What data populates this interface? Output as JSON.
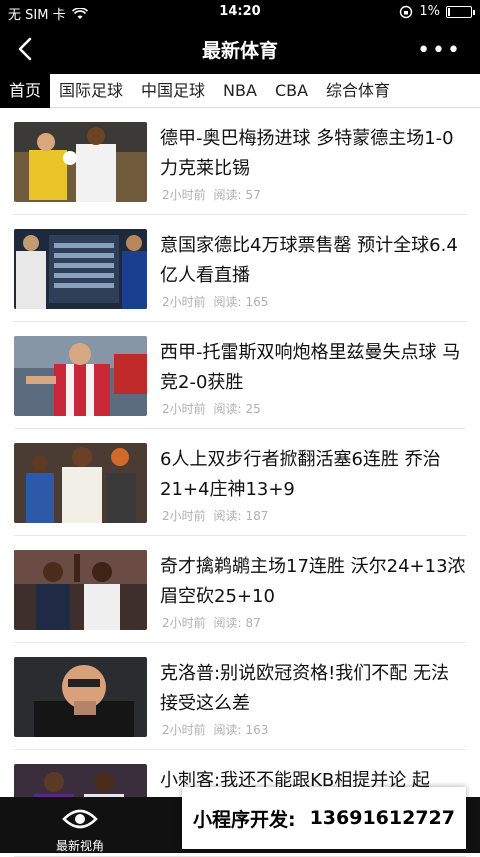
{
  "status_bar": {
    "carrier": "无 SIM 卡",
    "time": "14:20",
    "battery": "1%"
  },
  "header": {
    "title": "最新体育",
    "more": "•••"
  },
  "tabs": [
    {
      "label": "首页",
      "active": true
    },
    {
      "label": "国际足球"
    },
    {
      "label": "中国足球"
    },
    {
      "label": "NBA"
    },
    {
      "label": "CBA"
    },
    {
      "label": "综合体育"
    }
  ],
  "articles": [
    {
      "title": "德甲-奥巴梅扬进球 多特蒙德主场1-0力克莱比锡",
      "time": "2小时前",
      "reads_label": "阅读:",
      "reads": "57"
    },
    {
      "title": "意国家德比4万球票售罄 预计全球6.4亿人看直播",
      "time": "2小时前",
      "reads_label": "阅读:",
      "reads": "165"
    },
    {
      "title": "西甲-托雷斯双响炮格里兹曼失点球 马竞2-0获胜",
      "time": "2小时前",
      "reads_label": "阅读:",
      "reads": "25"
    },
    {
      "title": "6人上双步行者掀翻活塞6连胜 乔治21+4庄神13+9",
      "time": "2小时前",
      "reads_label": "阅读:",
      "reads": "187"
    },
    {
      "title": "奇才擒鹈鹕主场17连胜 沃尔24+13浓眉空砍25+10",
      "time": "2小时前",
      "reads_label": "阅读:",
      "reads": "87"
    },
    {
      "title": "克洛普:别说欧冠资格!我们不配 无法接受这么差",
      "time": "2小时前",
      "reads_label": "阅读:",
      "reads": "163"
    },
    {
      "title": "小刺客:我还不能跟KB相提并论 起",
      "time": "",
      "reads_label": "",
      "reads": ""
    }
  ],
  "bottom_nav": {
    "tab1_label": "最新视角"
  },
  "promo": {
    "label": "小程序开发:",
    "phone": "13691612727"
  },
  "colors": {
    "bar": "#000000",
    "meta": "#b0b0b0"
  }
}
